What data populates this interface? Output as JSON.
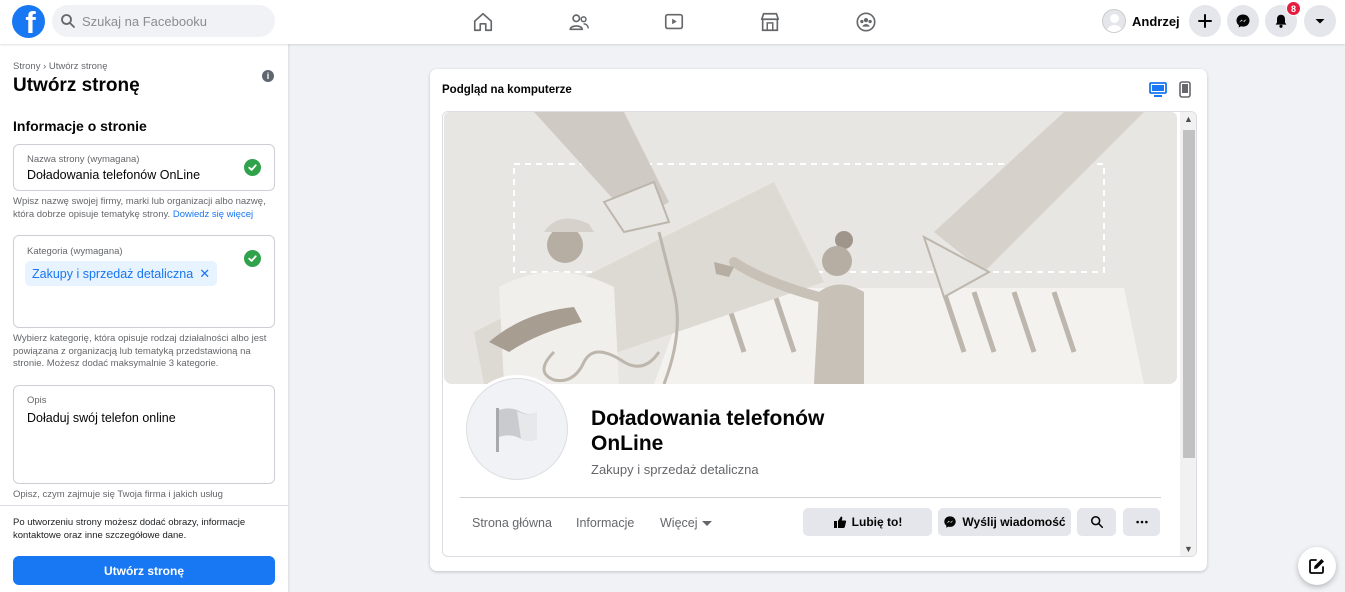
{
  "topbar": {
    "search_placeholder": "Szukaj na Facebooku",
    "user_name": "Andrzej",
    "notification_count": "8",
    "brand_color": "#1877f2"
  },
  "left": {
    "breadcrumb": "Strony › Utwórz stronę",
    "title": "Utwórz stronę",
    "section_title": "Informacje o stronie",
    "name_field": {
      "label": "Nazwa strony (wymagana)",
      "value": "Doładowania telefonów OnLine",
      "help": "Wpisz nazwę swojej firmy, marki lub organizacji albo nazwę, która dobrze opisuje tematykę strony.",
      "help_link": "Dowiedz się więcej"
    },
    "category_field": {
      "label": "Kategoria (wymagana)",
      "chip": "Zakupy i sprzedaż detaliczna",
      "help": "Wybierz kategorię, która opisuje rodzaj działalności albo jest powiązana z organizacją lub tematyką przedstawioną na stronie. Możesz dodać maksymalnie 3 kategorie."
    },
    "description_field": {
      "label": "Opis",
      "value": "Doładuj swój telefon online",
      "help": "Opisz, czym zajmuje się Twoja firma i jakich usług"
    },
    "footer_text": "Po utworzeniu strony możesz dodać obrazy, informacje kontaktowe oraz inne szczegółowe dane.",
    "create_button": "Utwórz stronę"
  },
  "preview": {
    "title": "Podgląd na komputerze",
    "page_name_line1": "Doładowania telefonów",
    "page_name_line2": "OnLine",
    "category": "Zakupy i sprzedaż detaliczna",
    "tabs": [
      "Strona główna",
      "Informacje",
      "Więcej"
    ],
    "like_button": "Lubię to!",
    "message_button": "Wyślij wiadomość"
  }
}
